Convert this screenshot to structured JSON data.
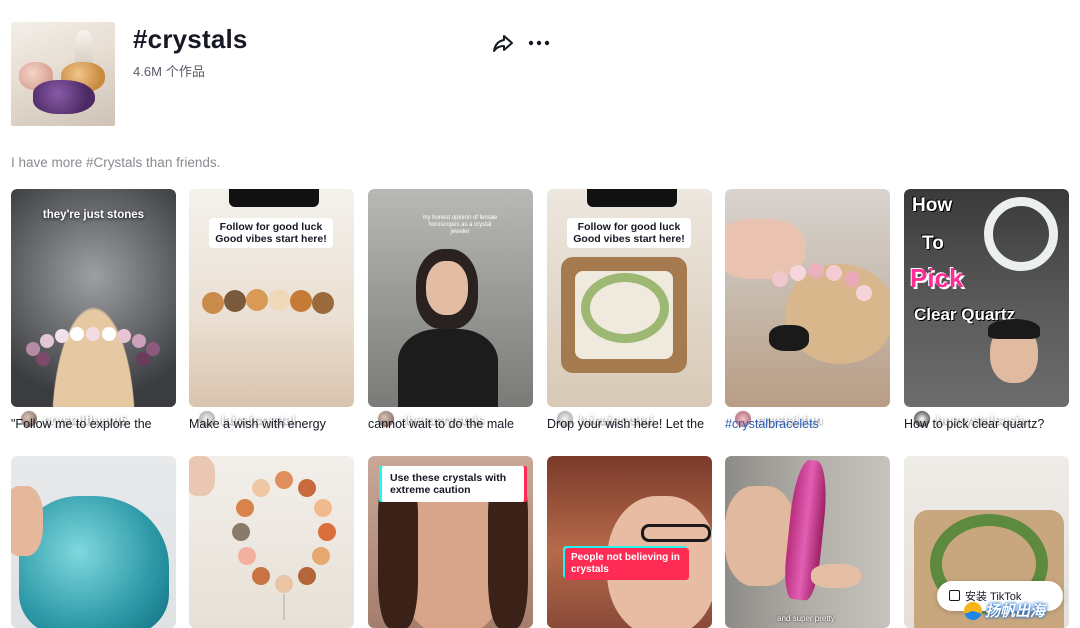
{
  "header": {
    "title": "#crystals",
    "count": "4.6M",
    "count_unit": "个作品",
    "description": "I have more #Crystals than friends."
  },
  "actions": {
    "share_icon": "share-icon",
    "more_icon": "more-dots-icon"
  },
  "videos": [
    {
      "author": "crystalfluent6",
      "caption": "\"Follow me to explore the",
      "overlay": "they're just stones"
    },
    {
      "author": "laicaicrystal",
      "caption": "Make a wish with energy",
      "overlay_line1": "Follow for good luck",
      "overlay_line2": "Good vibes start here!"
    },
    {
      "author": "cherucrystals",
      "caption": "cannot wait to do the male",
      "overlay": "my honest opinion of female horoscopes as a crystal jeweler"
    },
    {
      "author": "laicaicrystal",
      "caption": "Drop your wish here! Let the",
      "overlay_line1": "Follow for good luck",
      "overlay_line2": "Good vibes start here!"
    },
    {
      "author": "crystal.fun",
      "caption": "#crystalbracelets"
    },
    {
      "author": "hqcrystalsasia",
      "caption": "How to pick clear quartz?",
      "overlay_words": [
        "How",
        "To",
        "Pick",
        "Clear Quartz"
      ]
    },
    {
      "overlay": ""
    },
    {
      "overlay": ""
    },
    {
      "overlay": "Use these crystals with extreme caution"
    },
    {
      "overlay": "People not believing in crystals"
    },
    {
      "overlay": "and super pretty"
    },
    {
      "overlay": ""
    }
  ],
  "install_button": "安装 TikTok",
  "watermark": "扬帆出海",
  "colors": {
    "link": "#2b5db5",
    "muted": "#8a8b91",
    "accent_pink": "#fe2c55",
    "accent_cyan": "#25f4ee"
  }
}
